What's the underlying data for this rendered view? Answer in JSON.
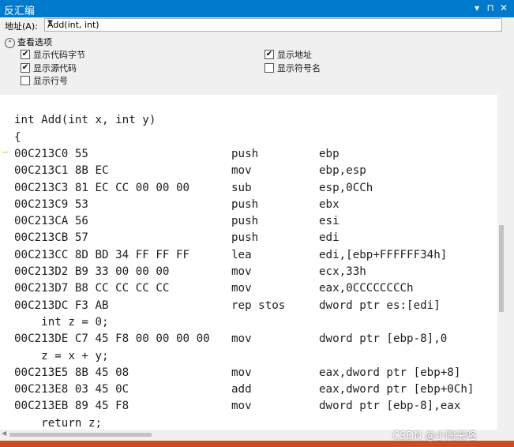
{
  "window": {
    "title": "反汇编",
    "buttons": [
      "▾",
      "⊓",
      "✕"
    ]
  },
  "address": {
    "label": "地址(A):",
    "value": "Add(int, int)"
  },
  "options": {
    "title": "查看选项",
    "items": [
      {
        "label": "显示代码字节",
        "checked": true
      },
      {
        "label": "显示地址",
        "checked": true
      },
      {
        "label": "显示源代码",
        "checked": true
      },
      {
        "label": "显示符号名",
        "checked": false
      },
      {
        "label": "显示行号",
        "checked": false
      }
    ]
  },
  "code": {
    "lines": [
      {
        "kind": "blank"
      },
      {
        "kind": "src",
        "text": "int Add(int x, int y)"
      },
      {
        "kind": "src",
        "text": "{"
      },
      {
        "kind": "asm",
        "addr": "00C213C0 55",
        "mn": "push",
        "op": "ebp",
        "current": true
      },
      {
        "kind": "asm",
        "addr": "00C213C1 8B EC",
        "mn": "mov",
        "op": "ebp,esp"
      },
      {
        "kind": "asm",
        "addr": "00C213C3 81 EC CC 00 00 00",
        "mn": "sub",
        "op": "esp,0CCh"
      },
      {
        "kind": "asm",
        "addr": "00C213C9 53",
        "mn": "push",
        "op": "ebx"
      },
      {
        "kind": "asm",
        "addr": "00C213CA 56",
        "mn": "push",
        "op": "esi"
      },
      {
        "kind": "asm",
        "addr": "00C213CB 57",
        "mn": "push",
        "op": "edi"
      },
      {
        "kind": "asm",
        "addr": "00C213CC 8D BD 34 FF FF FF",
        "mn": "lea",
        "op": "edi,[ebp+FFFFFF34h]"
      },
      {
        "kind": "asm",
        "addr": "00C213D2 B9 33 00 00 00",
        "mn": "mov",
        "op": "ecx,33h"
      },
      {
        "kind": "asm",
        "addr": "00C213D7 B8 CC CC CC CC",
        "mn": "mov",
        "op": "eax,0CCCCCCCCh"
      },
      {
        "kind": "asm",
        "addr": "00C213DC F3 AB",
        "mn": "rep stos",
        "op": "dword ptr es:[edi]"
      },
      {
        "kind": "src",
        "text": "    int z = 0;"
      },
      {
        "kind": "asm",
        "addr": "00C213DE C7 45 F8 00 00 00 00",
        "mn": "mov",
        "op": "dword ptr [ebp-8],0"
      },
      {
        "kind": "src",
        "text": "    z = x + y;"
      },
      {
        "kind": "asm",
        "addr": "00C213E5 8B 45 08",
        "mn": "mov",
        "op": "eax,dword ptr [ebp+8]"
      },
      {
        "kind": "asm",
        "addr": "00C213E8 03 45 0C",
        "mn": "add",
        "op": "eax,dword ptr [ebp+0Ch]"
      },
      {
        "kind": "asm",
        "addr": "00C213EB 89 45 F8",
        "mn": "mov",
        "op": "dword ptr [ebp-8],eax"
      },
      {
        "kind": "src",
        "text": "    return z;"
      }
    ]
  },
  "watermark": "CSDN @小陶来咯",
  "colors": {
    "titlebar": "#007acc",
    "bottom": "#d04a20",
    "arrow": "#e0b000"
  }
}
